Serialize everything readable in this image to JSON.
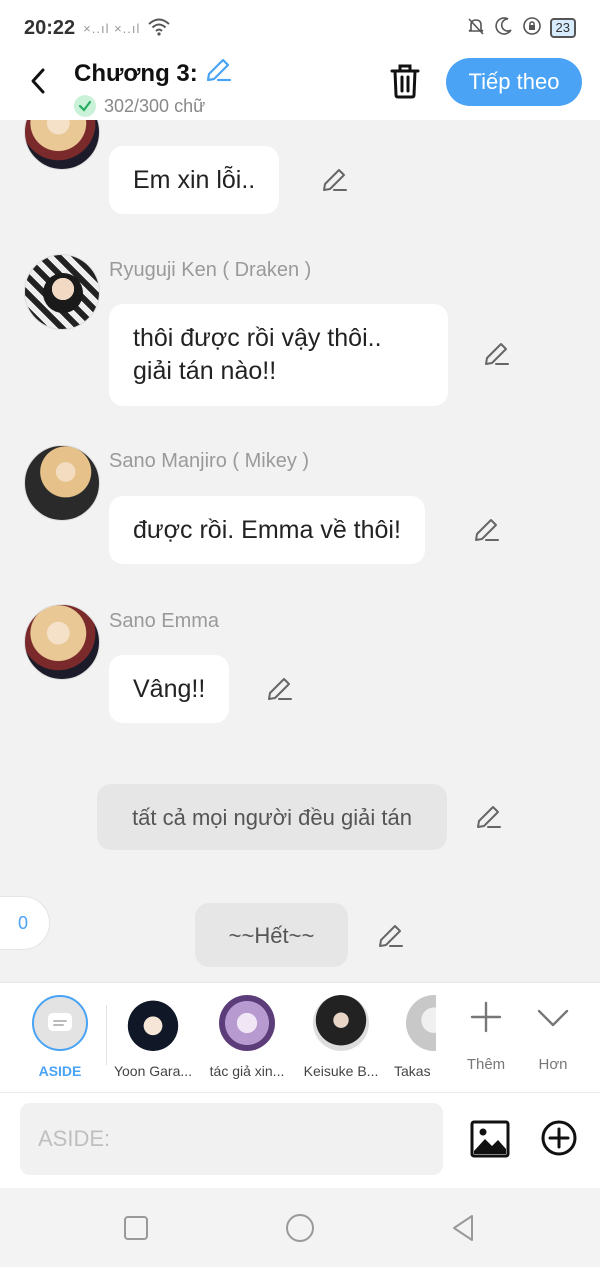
{
  "status_bar": {
    "time": "20:22",
    "signal_text": "×..ıl ×..ıl",
    "battery": "23"
  },
  "header": {
    "title": "Chương 3:",
    "word_count": "302/300 chữ",
    "next_button": "Tiếp theo"
  },
  "chat": {
    "messages": [
      {
        "sender": "",
        "text": "Em xin lỗi.."
      },
      {
        "sender": "Ryuguji Ken ( Draken )",
        "text_line1": "thôi được rồi vậy thôi..",
        "text_line2": "giải tán nào!!"
      },
      {
        "sender": "Sano Manjiro ( Mikey )",
        "text": "được rồi. Emma về thôi!"
      },
      {
        "sender": "Sano Emma",
        "text": "Vâng!!"
      }
    ],
    "asides": [
      {
        "text": "tất cả mọi người đều giải tán"
      },
      {
        "text": "~~Hết~~"
      }
    ],
    "counter": "0"
  },
  "character_bar": {
    "characters": [
      {
        "name": "ASIDE"
      },
      {
        "name": "Yoon Gara..."
      },
      {
        "name": "tác giả xin..."
      },
      {
        "name": "Keisuke B..."
      },
      {
        "name": "Takas"
      }
    ],
    "more_label": "Thêm",
    "expand_label": "Hơn"
  },
  "input": {
    "placeholder": "ASIDE:",
    "value": ""
  },
  "colors": {
    "accent": "#4aa3f5",
    "background": "#f2f2f2"
  }
}
